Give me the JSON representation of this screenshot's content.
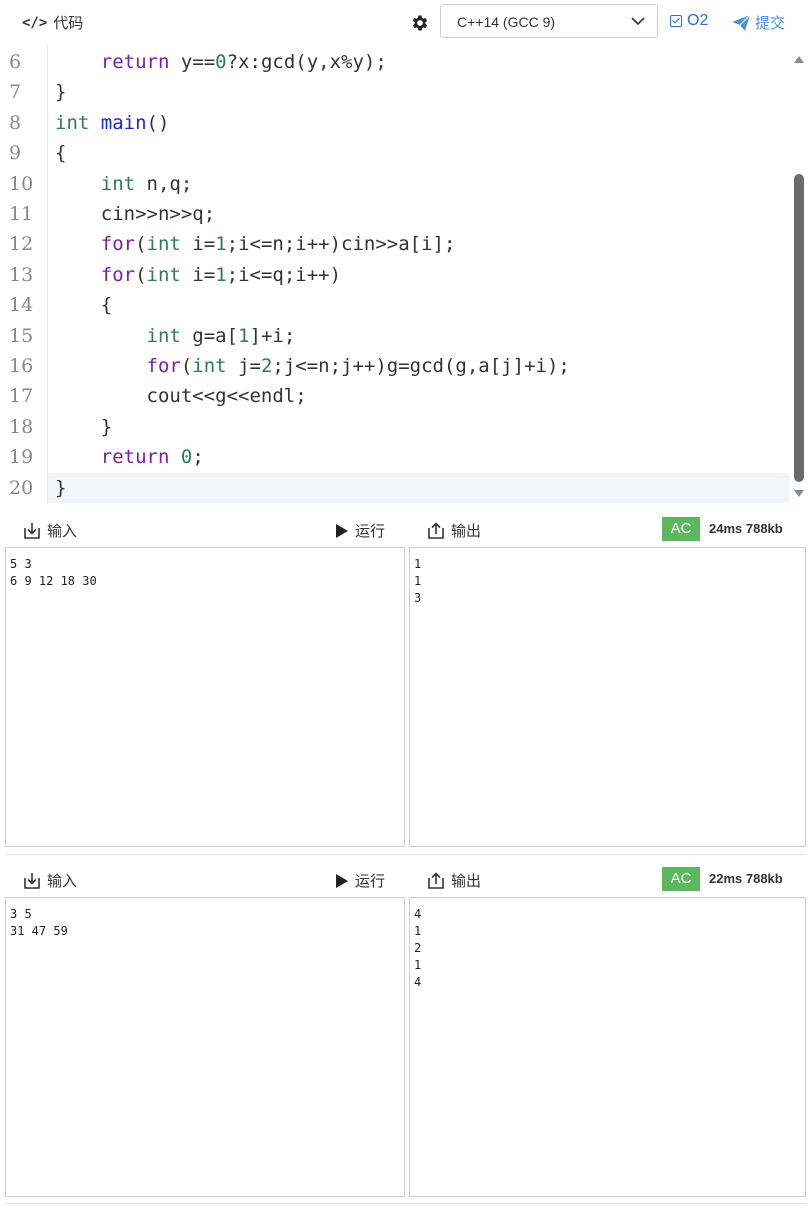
{
  "header": {
    "code_title": "代码",
    "language": "C++14 (GCC 9)",
    "o2_label": "O2",
    "submit_label": "提交"
  },
  "editor": {
    "lines": [
      {
        "no": "6",
        "code": [
          [
            "",
            "    "
          ],
          [
            "kw",
            "return"
          ],
          [
            "",
            " y=="
          ],
          [
            "num",
            "0"
          ],
          [
            "",
            "?x:gcd(y,x%y);"
          ]
        ]
      },
      {
        "no": "7",
        "code": [
          [
            "",
            "}"
          ]
        ]
      },
      {
        "no": "8",
        "code": [
          [
            "ty",
            "int"
          ],
          [
            "",
            " "
          ],
          [
            "fn",
            "main"
          ],
          [
            "",
            "()"
          ]
        ]
      },
      {
        "no": "9",
        "code": [
          [
            "",
            "{"
          ]
        ]
      },
      {
        "no": "10",
        "code": [
          [
            "",
            "    "
          ],
          [
            "ty",
            "int"
          ],
          [
            "",
            " n,q;"
          ]
        ]
      },
      {
        "no": "11",
        "code": [
          [
            "",
            "    cin>>n>>q;"
          ]
        ]
      },
      {
        "no": "12",
        "code": [
          [
            "",
            "    "
          ],
          [
            "kw",
            "for"
          ],
          [
            "",
            "("
          ],
          [
            "ty",
            "int"
          ],
          [
            "",
            " i="
          ],
          [
            "num",
            "1"
          ],
          [
            "",
            ";i<=n;i++)cin>>a[i];"
          ]
        ]
      },
      {
        "no": "13",
        "code": [
          [
            "",
            "    "
          ],
          [
            "kw",
            "for"
          ],
          [
            "",
            "("
          ],
          [
            "ty",
            "int"
          ],
          [
            "",
            " i="
          ],
          [
            "num",
            "1"
          ],
          [
            "",
            ";i<=q;i++)"
          ]
        ]
      },
      {
        "no": "14",
        "code": [
          [
            "",
            "    {"
          ]
        ]
      },
      {
        "no": "15",
        "code": [
          [
            "",
            "        "
          ],
          [
            "ty",
            "int"
          ],
          [
            "",
            " g=a["
          ],
          [
            "num",
            "1"
          ],
          [
            "",
            "]+i;"
          ]
        ]
      },
      {
        "no": "16",
        "code": [
          [
            "",
            "        "
          ],
          [
            "kw",
            "for"
          ],
          [
            "",
            "("
          ],
          [
            "ty",
            "int"
          ],
          [
            "",
            " j="
          ],
          [
            "num",
            "2"
          ],
          [
            "",
            ";j<=n;j++)g=gcd(g,a[j]+i);"
          ]
        ]
      },
      {
        "no": "17",
        "code": [
          [
            "",
            "        cout<<g<<endl;"
          ]
        ]
      },
      {
        "no": "18",
        "code": [
          [
            "",
            "    }"
          ]
        ]
      },
      {
        "no": "19",
        "code": [
          [
            "",
            "    "
          ],
          [
            "kw",
            "return"
          ],
          [
            "",
            " "
          ],
          [
            "num",
            "0"
          ],
          [
            "",
            ";"
          ]
        ]
      },
      {
        "no": "20",
        "code": [
          [
            "",
            "}"
          ]
        ]
      }
    ]
  },
  "cases": [
    {
      "input_label": "输入",
      "run_label": "运行",
      "output_label": "输出",
      "verdict": "AC",
      "stats": "24ms 788kb",
      "input_text": "5 3\n6 9 12 18 30",
      "output_text": "1\n1\n3"
    },
    {
      "input_label": "输入",
      "run_label": "运行",
      "output_label": "输出",
      "verdict": "AC",
      "stats": "22ms 788kb",
      "input_text": "3 5\n31 47 59",
      "output_text": "4\n1\n2\n1\n4"
    }
  ],
  "colors": {
    "verdict_ac": "#5cb85c",
    "accent_blue": "#2b6fd6",
    "keyword": "#7a1fa3",
    "type": "#2e7d4f",
    "function": "#1a2ad6"
  }
}
